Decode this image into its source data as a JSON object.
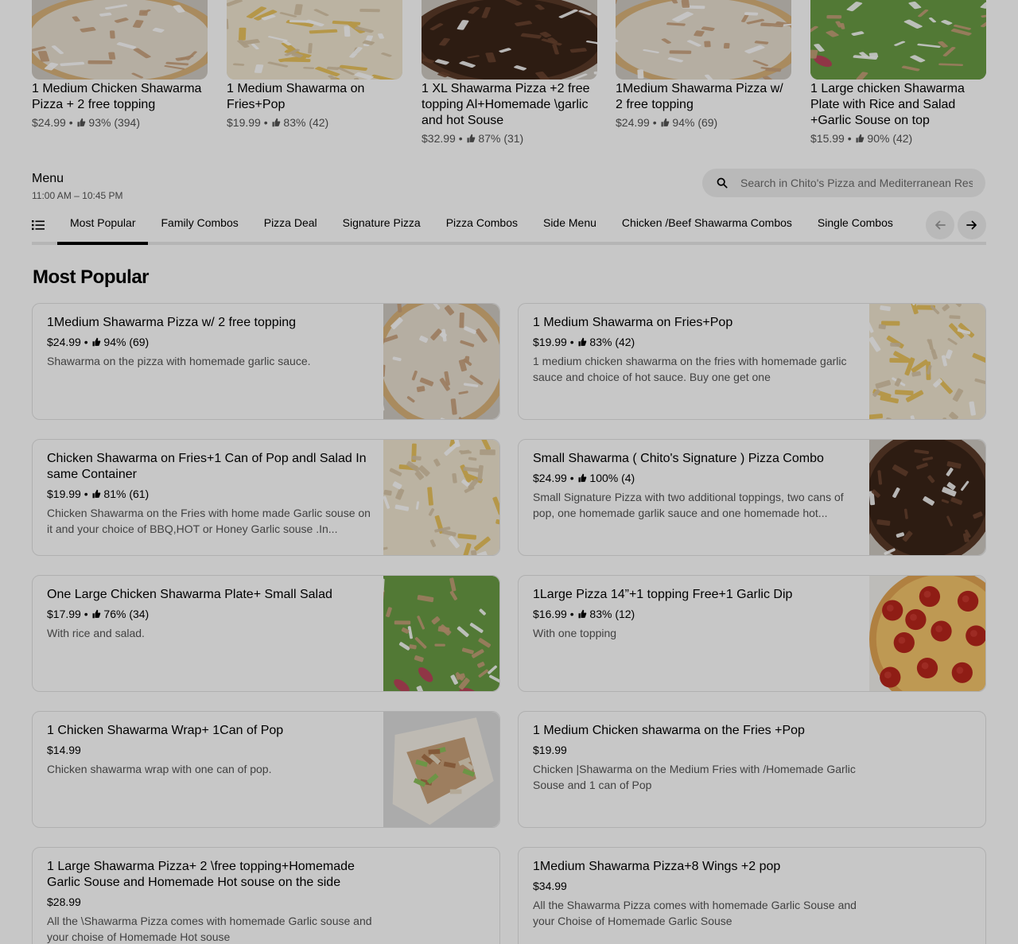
{
  "featured": [
    {
      "title": "1 Medium Chicken Shawarma Pizza + 2 free topping",
      "price": "$24.99",
      "rating": "93% (394)",
      "image": "shawarma-pizza"
    },
    {
      "title": "1 Medium Shawarma on Fries+Pop",
      "price": "$19.99",
      "rating": "83% (42)",
      "image": "shawarma-fries"
    },
    {
      "title": "1 XL Shawarma Pizza +2 free topping Al+Homemade \\garlic and hot Souse",
      "price": "$32.99",
      "rating": "87% (31)",
      "image": "xl-shawarma-pizza"
    },
    {
      "title": "1Medium Shawarma Pizza w/ 2 free topping",
      "price": "$24.99",
      "rating": "94% (69)",
      "image": "shawarma-pizza"
    },
    {
      "title": "1 Large  chicken Shawarma Plate with Rice and Salad +Garlic Souse on top",
      "price": "$15.99",
      "rating": "90% (42)",
      "image": "shawarma-plate"
    }
  ],
  "menu": {
    "title": "Menu",
    "hours": "11:00 AM – 10:45 PM",
    "search_placeholder": "Search in Chito's Pizza and Mediterranean Restaurant"
  },
  "tabs": [
    "Most Popular",
    "Family Combos",
    "Pizza Deal",
    "Signature Pizza",
    "Pizza Combos",
    "Side Menu",
    "Chicken /Beef Shawarma Combos",
    "Single Combos"
  ],
  "active_tab": "Most Popular",
  "section": {
    "title": "Most Popular"
  },
  "items": [
    {
      "name": "1Medium Shawarma Pizza w/ 2 free topping",
      "price": "$24.99",
      "rating": "94% (69)",
      "desc": "Shawarma on the pizza with homemade garlic sauce.",
      "image": "shawarma-pizza"
    },
    {
      "name": "1 Medium Shawarma on Fries+Pop",
      "price": "$19.99",
      "rating": "83% (42)",
      "desc": "1 medium chicken shawarma on the fries with homemade garlic sauce and choice of hot sauce. Buy one get one",
      "image": "shawarma-fries"
    },
    {
      "name": "Chicken Shawarma on Fries+1 Can of Pop andl Salad In same Container",
      "price": "$19.99",
      "rating": "81% (61)",
      "desc": "Chicken Shawarma on the Fries with home made Garlic souse on it and your choice of BBQ,HOT or Honey Garlic souse .In...",
      "image": "shawarma-fries-salad"
    },
    {
      "name": "Small Shawarma ( Chito's Signature ) Pizza Combo",
      "price": "$24.99",
      "rating": "100% (4)",
      "desc": "Small Signature Pizza with two additional toppings, two cans of pop, one homemade garlik sauce and one homemade hot...",
      "image": "xl-shawarma-pizza"
    },
    {
      "name": "One Large  Chicken Shawarma Plate+ Small Salad",
      "price": "$17.99",
      "rating": "76% (34)",
      "desc": "With rice and salad.",
      "image": "shawarma-plate"
    },
    {
      "name": "1Large Pizza 14”+1 topping Free+1 Garlic Dip",
      "price": "$16.99",
      "rating": "83% (12)",
      "desc": "With one topping",
      "image": "pepperoni-pizza"
    },
    {
      "name": "1 Chicken Shawarma Wrap+ 1Can of Pop",
      "price": "$14.99",
      "rating": "",
      "desc": "Chicken shawarma wrap with one can of pop.",
      "image": "shawarma-wrap"
    },
    {
      "name": "1 Medium Chicken shawarma on the Fries +Pop",
      "price": "$19.99",
      "rating": "",
      "desc": "Chicken |Shawarma on the Medium Fries with /Homemade Garlic Souse and 1 can of Pop",
      "image": ""
    },
    {
      "name": "1 Large Shawarma Pizza+ 2 \\free topping+Homemade Garlic Souse and Homemade Hot souse on the side",
      "price": "$28.99",
      "rating": "",
      "desc": "All the \\Shawarma Pizza comes with homemade Garlic souse and your choise of Homemade Hot souse",
      "image": ""
    },
    {
      "name": "1Medium Shawarma Pizza+8 Wings +2 pop",
      "price": "$34.99",
      "rating": "",
      "desc": "All the Shawarma Pizza comes with homemade Garlic Souse and your Choise of Homemade Garlic Souse",
      "image": ""
    }
  ],
  "colors": {
    "overlay": "rgba(0,0,0,0.22)",
    "text": "#000000",
    "muted": "#545454",
    "border": "#e2e2e2",
    "search_bg": "#eeeeee"
  }
}
